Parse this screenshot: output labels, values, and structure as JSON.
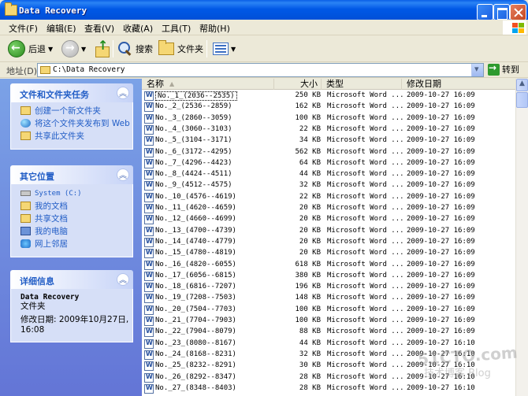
{
  "window": {
    "title": "Data Recovery"
  },
  "menu": [
    {
      "label": "文件(F)"
    },
    {
      "label": "编辑(E)"
    },
    {
      "label": "查看(V)"
    },
    {
      "label": "收藏(A)"
    },
    {
      "label": "工具(T)"
    },
    {
      "label": "帮助(H)"
    }
  ],
  "toolbar": {
    "back_label": "后退",
    "search_label": "搜索",
    "folders_label": "文件夹"
  },
  "address": {
    "label": "地址(D)",
    "path": "C:\\Data Recovery",
    "go_label": "转到"
  },
  "tasks_panel": {
    "title": "文件和文件夹任务",
    "items": [
      {
        "label": "创建一个新文件夹",
        "icon": "new-folder-icon"
      },
      {
        "label": "将这个文件夹发布到 Web",
        "icon": "publish-web-icon"
      },
      {
        "label": "共享此文件夹",
        "icon": "share-folder-icon"
      }
    ]
  },
  "places_panel": {
    "title": "其它位置",
    "items": [
      {
        "label": "System (C:)",
        "icon": "drive-icon"
      },
      {
        "label": "我的文档",
        "icon": "my-documents-icon"
      },
      {
        "label": "共享文档",
        "icon": "shared-documents-icon"
      },
      {
        "label": "我的电脑",
        "icon": "my-computer-icon"
      },
      {
        "label": "网上邻居",
        "icon": "network-places-icon"
      }
    ]
  },
  "details_panel": {
    "title": "详细信息",
    "name": "Data Recovery",
    "type": "文件夹",
    "modified": "修改日期: 2009年10月27日, 16:08"
  },
  "columns": {
    "name": "名称",
    "size": "大小",
    "type": "类型",
    "modified": "修改日期"
  },
  "files": [
    {
      "name": "No._1_(2036--2535)",
      "size": "250 KB",
      "type": "Microsoft Word ...",
      "modified": "2009-10-27 16:09"
    },
    {
      "name": "No._2_(2536--2859)",
      "size": "162 KB",
      "type": "Microsoft Word ...",
      "modified": "2009-10-27 16:09"
    },
    {
      "name": "No._3_(2860--3059)",
      "size": "100 KB",
      "type": "Microsoft Word ...",
      "modified": "2009-10-27 16:09"
    },
    {
      "name": "No._4_(3060--3103)",
      "size": "22 KB",
      "type": "Microsoft Word ...",
      "modified": "2009-10-27 16:09"
    },
    {
      "name": "No._5_(3104--3171)",
      "size": "34 KB",
      "type": "Microsoft Word ...",
      "modified": "2009-10-27 16:09"
    },
    {
      "name": "No._6_(3172--4295)",
      "size": "562 KB",
      "type": "Microsoft Word ...",
      "modified": "2009-10-27 16:09"
    },
    {
      "name": "No._7_(4296--4423)",
      "size": "64 KB",
      "type": "Microsoft Word ...",
      "modified": "2009-10-27 16:09"
    },
    {
      "name": "No._8_(4424--4511)",
      "size": "44 KB",
      "type": "Microsoft Word ...",
      "modified": "2009-10-27 16:09"
    },
    {
      "name": "No._9_(4512--4575)",
      "size": "32 KB",
      "type": "Microsoft Word ...",
      "modified": "2009-10-27 16:09"
    },
    {
      "name": "No._10_(4576--4619)",
      "size": "22 KB",
      "type": "Microsoft Word ...",
      "modified": "2009-10-27 16:09"
    },
    {
      "name": "No._11_(4620--4659)",
      "size": "20 KB",
      "type": "Microsoft Word ...",
      "modified": "2009-10-27 16:09"
    },
    {
      "name": "No._12_(4660--4699)",
      "size": "20 KB",
      "type": "Microsoft Word ...",
      "modified": "2009-10-27 16:09"
    },
    {
      "name": "No._13_(4700--4739)",
      "size": "20 KB",
      "type": "Microsoft Word ...",
      "modified": "2009-10-27 16:09"
    },
    {
      "name": "No._14_(4740--4779)",
      "size": "20 KB",
      "type": "Microsoft Word ...",
      "modified": "2009-10-27 16:09"
    },
    {
      "name": "No._15_(4780--4819)",
      "size": "20 KB",
      "type": "Microsoft Word ...",
      "modified": "2009-10-27 16:09"
    },
    {
      "name": "No._16_(4820--6055)",
      "size": "618 KB",
      "type": "Microsoft Word ...",
      "modified": "2009-10-27 16:09"
    },
    {
      "name": "No._17_(6056--6815)",
      "size": "380 KB",
      "type": "Microsoft Word ...",
      "modified": "2009-10-27 16:09"
    },
    {
      "name": "No._18_(6816--7207)",
      "size": "196 KB",
      "type": "Microsoft Word ...",
      "modified": "2009-10-27 16:09"
    },
    {
      "name": "No._19_(7208--7503)",
      "size": "148 KB",
      "type": "Microsoft Word ...",
      "modified": "2009-10-27 16:09"
    },
    {
      "name": "No._20_(7504--7703)",
      "size": "100 KB",
      "type": "Microsoft Word ...",
      "modified": "2009-10-27 16:09"
    },
    {
      "name": "No._21_(7704--7903)",
      "size": "100 KB",
      "type": "Microsoft Word ...",
      "modified": "2009-10-27 16:09"
    },
    {
      "name": "No._22_(7904--8079)",
      "size": "88 KB",
      "type": "Microsoft Word ...",
      "modified": "2009-10-27 16:09"
    },
    {
      "name": "No._23_(8080--8167)",
      "size": "44 KB",
      "type": "Microsoft Word ...",
      "modified": "2009-10-27 16:10"
    },
    {
      "name": "No._24_(8168--8231)",
      "size": "32 KB",
      "type": "Microsoft Word ...",
      "modified": "2009-10-27 16:10"
    },
    {
      "name": "No._25_(8232--8291)",
      "size": "30 KB",
      "type": "Microsoft Word ...",
      "modified": "2009-10-27 16:10"
    },
    {
      "name": "No._26_(8292--8347)",
      "size": "28 KB",
      "type": "Microsoft Word ...",
      "modified": "2009-10-27 16:10"
    },
    {
      "name": "No._27_(8348--8403)",
      "size": "28 KB",
      "type": "Microsoft Word ...",
      "modified": "2009-10-27 16:10"
    }
  ],
  "watermark": {
    "line1": "51CTO.com",
    "line2": "技术博客 Blog"
  }
}
